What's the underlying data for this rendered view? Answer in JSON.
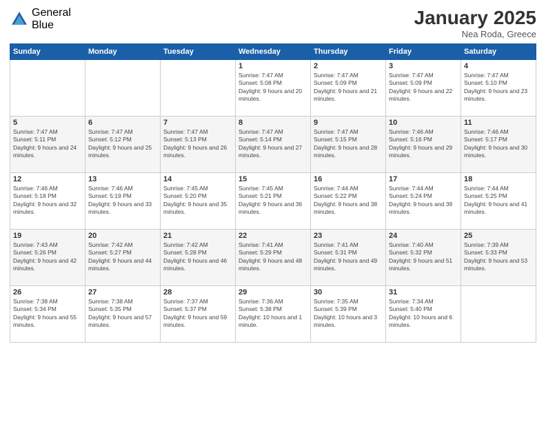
{
  "logo": {
    "general": "General",
    "blue": "Blue"
  },
  "title": "January 2025",
  "location": "Nea Roda, Greece",
  "headers": [
    "Sunday",
    "Monday",
    "Tuesday",
    "Wednesday",
    "Thursday",
    "Friday",
    "Saturday"
  ],
  "weeks": [
    [
      {
        "day": "",
        "info": ""
      },
      {
        "day": "",
        "info": ""
      },
      {
        "day": "",
        "info": ""
      },
      {
        "day": "1",
        "info": "Sunrise: 7:47 AM\nSunset: 5:08 PM\nDaylight: 9 hours and 20 minutes."
      },
      {
        "day": "2",
        "info": "Sunrise: 7:47 AM\nSunset: 5:09 PM\nDaylight: 9 hours and 21 minutes."
      },
      {
        "day": "3",
        "info": "Sunrise: 7:47 AM\nSunset: 5:09 PM\nDaylight: 9 hours and 22 minutes."
      },
      {
        "day": "4",
        "info": "Sunrise: 7:47 AM\nSunset: 5:10 PM\nDaylight: 9 hours and 23 minutes."
      }
    ],
    [
      {
        "day": "5",
        "info": "Sunrise: 7:47 AM\nSunset: 5:11 PM\nDaylight: 9 hours and 24 minutes."
      },
      {
        "day": "6",
        "info": "Sunrise: 7:47 AM\nSunset: 5:12 PM\nDaylight: 9 hours and 25 minutes."
      },
      {
        "day": "7",
        "info": "Sunrise: 7:47 AM\nSunset: 5:13 PM\nDaylight: 9 hours and 26 minutes."
      },
      {
        "day": "8",
        "info": "Sunrise: 7:47 AM\nSunset: 5:14 PM\nDaylight: 9 hours and 27 minutes."
      },
      {
        "day": "9",
        "info": "Sunrise: 7:47 AM\nSunset: 5:15 PM\nDaylight: 9 hours and 28 minutes."
      },
      {
        "day": "10",
        "info": "Sunrise: 7:46 AM\nSunset: 5:16 PM\nDaylight: 9 hours and 29 minutes."
      },
      {
        "day": "11",
        "info": "Sunrise: 7:46 AM\nSunset: 5:17 PM\nDaylight: 9 hours and 30 minutes."
      }
    ],
    [
      {
        "day": "12",
        "info": "Sunrise: 7:46 AM\nSunset: 5:18 PM\nDaylight: 9 hours and 32 minutes."
      },
      {
        "day": "13",
        "info": "Sunrise: 7:46 AM\nSunset: 5:19 PM\nDaylight: 9 hours and 33 minutes."
      },
      {
        "day": "14",
        "info": "Sunrise: 7:45 AM\nSunset: 5:20 PM\nDaylight: 9 hours and 35 minutes."
      },
      {
        "day": "15",
        "info": "Sunrise: 7:45 AM\nSunset: 5:21 PM\nDaylight: 9 hours and 36 minutes."
      },
      {
        "day": "16",
        "info": "Sunrise: 7:44 AM\nSunset: 5:22 PM\nDaylight: 9 hours and 38 minutes."
      },
      {
        "day": "17",
        "info": "Sunrise: 7:44 AM\nSunset: 5:24 PM\nDaylight: 9 hours and 39 minutes."
      },
      {
        "day": "18",
        "info": "Sunrise: 7:44 AM\nSunset: 5:25 PM\nDaylight: 9 hours and 41 minutes."
      }
    ],
    [
      {
        "day": "19",
        "info": "Sunrise: 7:43 AM\nSunset: 5:26 PM\nDaylight: 9 hours and 42 minutes."
      },
      {
        "day": "20",
        "info": "Sunrise: 7:42 AM\nSunset: 5:27 PM\nDaylight: 9 hours and 44 minutes."
      },
      {
        "day": "21",
        "info": "Sunrise: 7:42 AM\nSunset: 5:28 PM\nDaylight: 9 hours and 46 minutes."
      },
      {
        "day": "22",
        "info": "Sunrise: 7:41 AM\nSunset: 5:29 PM\nDaylight: 9 hours and 48 minutes."
      },
      {
        "day": "23",
        "info": "Sunrise: 7:41 AM\nSunset: 5:31 PM\nDaylight: 9 hours and 49 minutes."
      },
      {
        "day": "24",
        "info": "Sunrise: 7:40 AM\nSunset: 5:32 PM\nDaylight: 9 hours and 51 minutes."
      },
      {
        "day": "25",
        "info": "Sunrise: 7:39 AM\nSunset: 5:33 PM\nDaylight: 9 hours and 53 minutes."
      }
    ],
    [
      {
        "day": "26",
        "info": "Sunrise: 7:38 AM\nSunset: 5:34 PM\nDaylight: 9 hours and 55 minutes."
      },
      {
        "day": "27",
        "info": "Sunrise: 7:38 AM\nSunset: 5:35 PM\nDaylight: 9 hours and 57 minutes."
      },
      {
        "day": "28",
        "info": "Sunrise: 7:37 AM\nSunset: 5:37 PM\nDaylight: 9 hours and 59 minutes."
      },
      {
        "day": "29",
        "info": "Sunrise: 7:36 AM\nSunset: 5:38 PM\nDaylight: 10 hours and 1 minute."
      },
      {
        "day": "30",
        "info": "Sunrise: 7:35 AM\nSunset: 5:39 PM\nDaylight: 10 hours and 3 minutes."
      },
      {
        "day": "31",
        "info": "Sunrise: 7:34 AM\nSunset: 5:40 PM\nDaylight: 10 hours and 6 minutes."
      },
      {
        "day": "",
        "info": ""
      }
    ]
  ]
}
